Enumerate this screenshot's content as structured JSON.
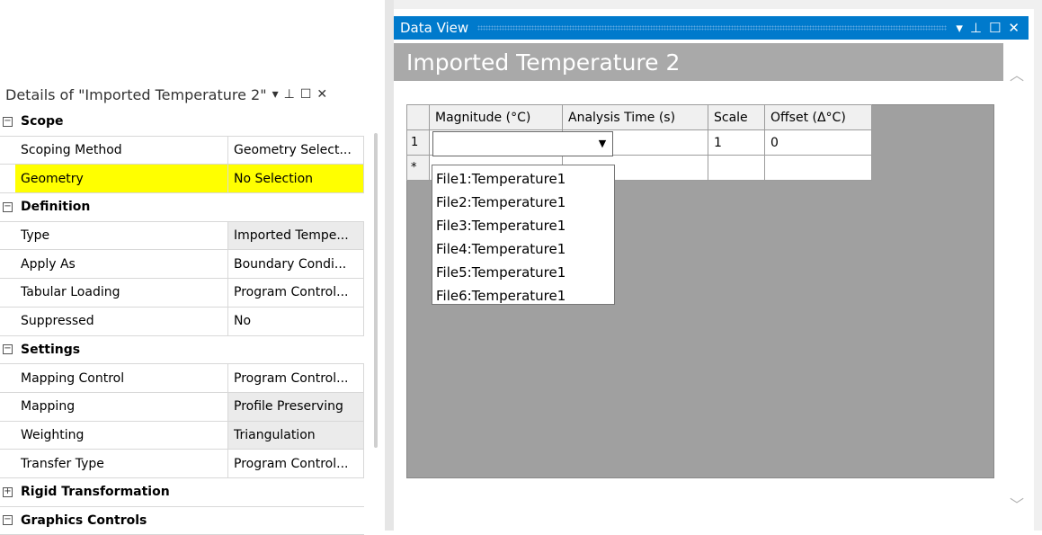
{
  "details": {
    "title": "Details of \"Imported Temperature 2\"",
    "tools": {
      "menu": "▾",
      "pin": "⊥",
      "max": "☐",
      "close": "✕"
    },
    "sections": [
      {
        "label": "Scope",
        "expander": "−",
        "rows": [
          {
            "name": "Scoping Method",
            "value": "Geometry Select..."
          },
          {
            "name": "Geometry",
            "value": "No Selection"
          }
        ]
      },
      {
        "label": "Definition",
        "expander": "−",
        "rows": [
          {
            "name": "Type",
            "value": "Imported Tempe..."
          },
          {
            "name": "Apply As",
            "value": "Boundary Condi..."
          },
          {
            "name": "Tabular Loading",
            "value": "Program Control..."
          },
          {
            "name": "Suppressed",
            "value": "No"
          }
        ]
      },
      {
        "label": "Settings",
        "expander": "−",
        "rows": [
          {
            "name": "Mapping Control",
            "value": "Program Control..."
          },
          {
            "name": "Mapping",
            "value": "Profile Preserving"
          },
          {
            "name": "Weighting",
            "value": "Triangulation"
          },
          {
            "name": "Transfer Type",
            "value": "Program Control..."
          }
        ]
      },
      {
        "label": "Rigid Transformation",
        "expander": "+"
      },
      {
        "label": "Graphics Controls",
        "expander": "−"
      }
    ]
  },
  "dataview": {
    "header": "Data View",
    "tools": {
      "menu": "▾",
      "pin": "⊥",
      "max": "☐",
      "close": "✕"
    },
    "title": "Imported Temperature 2",
    "columns": [
      "Magnitude (°C)",
      "Analysis Time (s)",
      "Scale",
      "Offset (Δ°C)"
    ],
    "rows": [
      {
        "header": "1",
        "cells": [
          "",
          "",
          "1",
          "0"
        ]
      },
      {
        "header": "*",
        "cells": [
          "",
          "",
          "",
          ""
        ]
      }
    ],
    "combo_arrow": "▼",
    "dropdown_options": [
      "File1:Temperature1",
      "File2:Temperature1",
      "File3:Temperature1",
      "File4:Temperature1",
      "File5:Temperature1",
      "File6:Temperature1"
    ],
    "scroll": {
      "up": "︿",
      "down": "﹀"
    }
  },
  "colors": {
    "highlight": "#ffff00",
    "header_blue": "#007acc",
    "title_gray": "#a9a9a9"
  }
}
